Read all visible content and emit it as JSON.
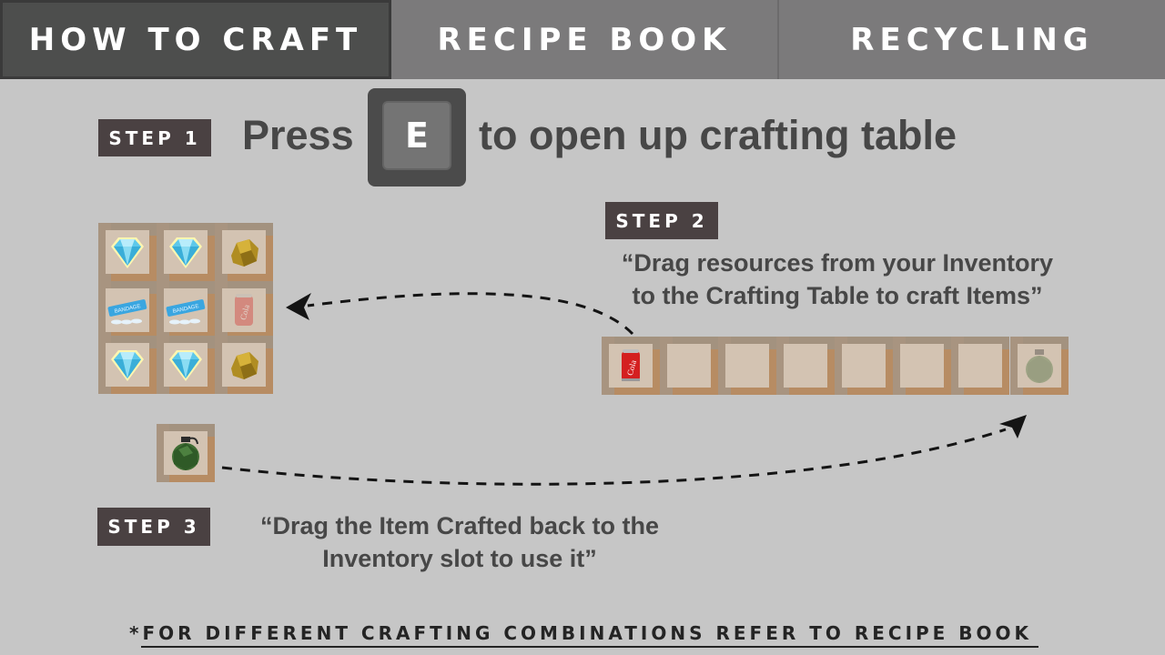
{
  "tabs": [
    {
      "label": "HOW TO CRAFT",
      "active": true
    },
    {
      "label": "RECIPE BOOK",
      "active": false
    },
    {
      "label": "RECYCLING",
      "active": false
    }
  ],
  "step1": {
    "badge": "STEP 1",
    "press": "Press",
    "key": "E",
    "rest": "to open up crafting table"
  },
  "step2": {
    "badge": "STEP 2",
    "line1": "“Drag resources from your Inventory",
    "line2": "to the Crafting Table to craft Items”"
  },
  "step3": {
    "badge": "STEP 3",
    "line1": "“Drag the Item Crafted back to the",
    "line2": "Inventory slot to use it”"
  },
  "crafting_grid": {
    "items": [
      "diamond-icon",
      "diamond-icon",
      "gold-nugget-icon",
      "bandage-icon",
      "bandage-icon",
      "cola-can-icon",
      "diamond-icon",
      "diamond-icon",
      "gold-nugget-icon"
    ],
    "item_labels": {
      "bandage": "BANDAGE",
      "cola": "Cola"
    },
    "ghost_item": "cola-can-icon"
  },
  "crafted_slot": {
    "item": "grenade-icon"
  },
  "inventory": {
    "slots": [
      "cola-can-icon",
      "",
      "",
      "",
      "",
      "",
      "",
      "grenade-icon"
    ],
    "ghost_slot": 7,
    "cola_label": "Cola"
  },
  "footer": "*FOR DIFFERENT CRAFTING COMBINATIONS REFER TO RECIPE BOOK",
  "colors": {
    "background": "#c6c6c6",
    "tab": "#7b7a7b",
    "tab_active": "#4d4e4d",
    "badge": "#4a4142",
    "text": "#474747",
    "slot_wood": "#b78c63",
    "slot_inner": "#d3c3b2"
  }
}
